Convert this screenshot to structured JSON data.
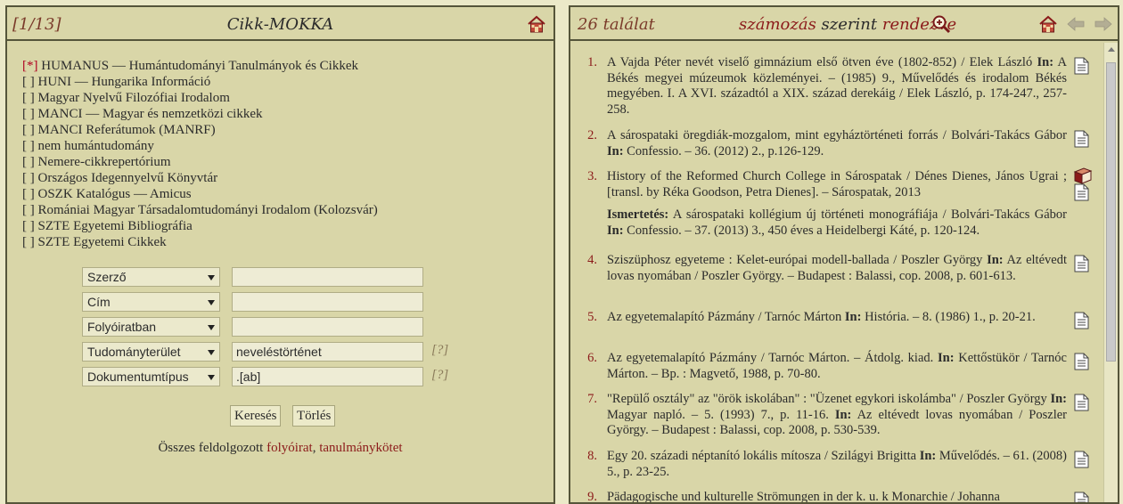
{
  "left": {
    "counter": "[1/13]",
    "title": "Cikk-MOKKA",
    "databases": [
      {
        "mark": "[*]",
        "checked": true,
        "label": "HUMANUS — Humántudományi Tanulmányok és Cikkek"
      },
      {
        "mark": "[  ]",
        "checked": false,
        "label": "HUNI — Hungarika Információ"
      },
      {
        "mark": "[  ]",
        "checked": false,
        "label": "Magyar Nyelvű Filozófiai Irodalom"
      },
      {
        "mark": "[  ]",
        "checked": false,
        "label": "MANCI — Magyar és nemzetközi cikkek"
      },
      {
        "mark": "[  ]",
        "checked": false,
        "label": "MANCI Referátumok (MANRF)"
      },
      {
        "mark": "[  ]",
        "checked": false,
        "label": "nem humántudomány"
      },
      {
        "mark": "[  ]",
        "checked": false,
        "label": "Nemere-cikkrepertórium"
      },
      {
        "mark": "[  ]",
        "checked": false,
        "label": "Országos Idegennyelvű Könyvtár"
      },
      {
        "mark": "[  ]",
        "checked": false,
        "label": "OSZK Katalógus — Amicus"
      },
      {
        "mark": "[  ]",
        "checked": false,
        "label": "Romániai Magyar Társadalomtudományi Irodalom (Kolozsvár)"
      },
      {
        "mark": "[  ]",
        "checked": false,
        "label": "SZTE Egyetemi Bibliográfia"
      },
      {
        "mark": "[  ]",
        "checked": false,
        "label": "SZTE Egyetemi Cikkek"
      }
    ],
    "form": [
      {
        "field": "Szerző",
        "value": "",
        "help": ""
      },
      {
        "field": "Cím",
        "value": "",
        "help": ""
      },
      {
        "field": "Folyóiratban",
        "value": "",
        "help": ""
      },
      {
        "field": "Tudományterület",
        "value": "neveléstörténet",
        "help": "[?]"
      },
      {
        "field": "Dokumentumtípus",
        "value": ".[ab]",
        "help": "[?]"
      }
    ],
    "search_label": "Keresés",
    "clear_label": "Törlés",
    "footer_prefix": "Összes feldolgozott",
    "footer_link1": "folyóirat",
    "footer_sep": ",",
    "footer_link2": "tanulmánykötet"
  },
  "right": {
    "count": "26 találat",
    "sort_link1": "számozás",
    "sort_mid": "szerint",
    "sort_link2": "rendezve",
    "results": [
      {
        "num": "1.",
        "text": "A Vajda Péter nevét viselő gimnázium első ötven éve (1802-852) / Elek László <b>In:</b> A Békés megyei múzeumok közleményei. – (1985) 9., Művelődés és irodalom Békés megyében. I. A XVI. századtól a XIX. század derekáig / Elek László, p. 174-247., 257-258."
      },
      {
        "num": "2.",
        "text": "A sárospataki öregdiák-mozgalom, mint egyháztörténeti forrás / Bolvári-Takács Gábor <b>In:</b> Confessio. – 36. (2012) 2., p.126-129."
      },
      {
        "num": "3.",
        "text": "History of the Reformed Church College in Sárospatak / Dénes Dienes, János Ugrai ; [transl. by Réka Goodson, Petra Dienes]. – Sárospatak, 2013"
      },
      {
        "num": "",
        "text": "<b>Ismertetés:</b> A sárospataki kollégium új történeti monográfiája / Bolvári-Takács Gábor <b>In:</b> Confessio. – 37. (2013) 3., 450 éves a Heidelbergi Káté, p. 120-124."
      },
      {
        "num": "4.",
        "text": "Sziszüphosz egyeteme : Kelet-európai modell-ballada / Poszler György <b>In:</b> Az eltévedt lovas nyomában / Poszler György. – Budapest : Balassi, cop. 2008, p. 601-613."
      },
      {
        "num": "5.",
        "text": "Az egyetemalapító Pázmány / Tarnóc Márton <b>In:</b> História. – 8. (1986) 1., p. 20-21."
      },
      {
        "num": "6.",
        "text": "Az egyetemalapító Pázmány / Tarnóc Márton. – Átdolg. kiad. <b>In:</b> Kettőstükör / Tarnóc Márton. – Bp. : Magvető, 1988, p. 70-80."
      },
      {
        "num": "7.",
        "text": "\"Repülő osztály\" az \"örök iskolában\" : \"Üzenet egykori iskolámba\" / Poszler György <b>In:</b> Magyar napló. – 5. (1993) 7., p. 11-16. <b>In:</b> Az eltévedt lovas nyomában / Poszler György. – Budapest : Balassi, cop. 2008, p. 530-539."
      },
      {
        "num": "8.",
        "text": "Egy 20. századi néptanító lokális mítosza / Szilágyi Brigitta <b>In:</b> Művelődés. – 61. (2008) 5., p. 23-25."
      },
      {
        "num": "9.",
        "text": "Pädagogische und kulturelle Strömungen in der k. u. k Monarchie / Johanna"
      }
    ]
  },
  "icons": {
    "home": "home-icon",
    "zoom": "zoom-in-icon",
    "back": "arrow-left-icon",
    "forward": "arrow-right-icon",
    "document": "document-icon",
    "book": "book-icon"
  }
}
